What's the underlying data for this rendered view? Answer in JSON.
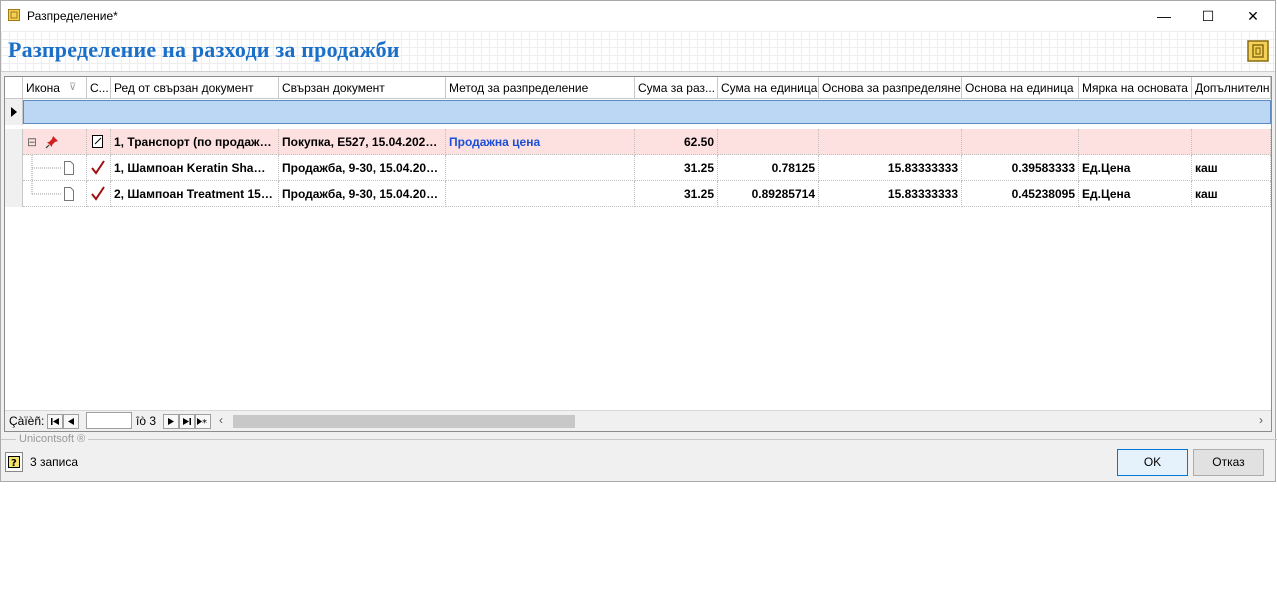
{
  "window": {
    "title": "Разпределение*",
    "minimize": "—",
    "maximize": "☐",
    "close": "✕"
  },
  "header": {
    "title": "Разпределение на разходи за продажби"
  },
  "grid": {
    "columns": [
      "Икона",
      "С...",
      "Ред от свързан документ",
      "Свързан документ",
      "Метод за разпределение",
      "Сума за раз...",
      "Сума на единица",
      "Основа за разпределяне",
      "Основа на единица",
      "Мярка на основата",
      "Допълнителн"
    ],
    "sort_indicator": "⊽",
    "rows": [
      {
        "expander": "⊟",
        "icon": "pin-icon",
        "status": "note-icon",
        "line": "1, Транспорт (по продажб...",
        "doc": "Покупка, Е527, 15.04.2024,...",
        "method": "Продажна цена",
        "amount": "62.50",
        "unit_amount": "",
        "base": "",
        "unit_base": "",
        "measure": "",
        "extra": ""
      },
      {
        "expander": "",
        "icon": "doc-icon",
        "status": "check-icon",
        "line": "1, Шампоан Keratin Shamp...",
        "doc": "Продажба, 9-30, 15.04.202...",
        "method": "",
        "amount": "31.25",
        "unit_amount": "0.78125",
        "base": "15.83333333",
        "unit_base": "0.39583333",
        "measure": "Ед.Цена",
        "extra": "каш"
      },
      {
        "expander": "",
        "icon": "doc-icon",
        "status": "check-icon",
        "line": "2, Шампоан Treatment 150...",
        "doc": "Продажба, 9-30, 15.04.202...",
        "method": "",
        "amount": "31.25",
        "unit_amount": "0.89285714",
        "base": "15.83333333",
        "unit_base": "0.45238095",
        "measure": "Ед.Цена",
        "extra": "каш"
      }
    ]
  },
  "navigator": {
    "label": "Çàïèñ:",
    "page_value": "",
    "of_text": "îò 3"
  },
  "brand": {
    "text": "Unicontsoft ®"
  },
  "status": {
    "records": "3 записа"
  },
  "buttons": {
    "ok": "OK",
    "cancel": "Отказ"
  }
}
